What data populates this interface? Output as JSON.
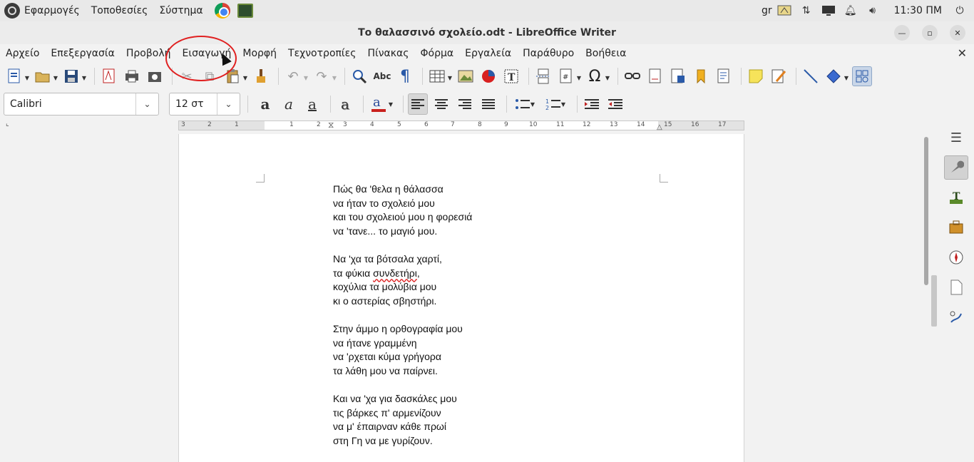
{
  "system_panel": {
    "menus": [
      "Εφαρμογές",
      "Τοποθεσίες",
      "Σύστημα"
    ],
    "keyboard_layout": "gr",
    "clock": "11:30 ΠΜ"
  },
  "window": {
    "title": "Το θαλασσινό σχολείο.odt - LibreOffice Writer"
  },
  "menubar": {
    "items": [
      "Αρχείο",
      "Επεξεργασία",
      "Προβολή",
      "Εισαγωγή",
      "Μορφή",
      "Τεχνοτροπίες",
      "Πίνακας",
      "Φόρμα",
      "Εργαλεία",
      "Παράθυρο",
      "Βοήθεια"
    ],
    "highlighted": "Εισαγωγή"
  },
  "formatting": {
    "font_name": "Calibri",
    "font_size": "12 στ",
    "font_color": "#c9211e"
  },
  "ruler": {
    "ticks": [
      "3",
      "2",
      "1",
      "1",
      "2",
      "3",
      "4",
      "5",
      "6",
      "7",
      "8",
      "9",
      "10",
      "11",
      "12",
      "13",
      "14",
      "15",
      "16",
      "17"
    ]
  },
  "document": {
    "stanzas": [
      [
        "Πώς θα 'θελα η θάλασσα",
        "να ήταν το σχολειό μου",
        "και του σχολειού μου η φορεσιά",
        "να 'τανε... το μαγιό μου."
      ],
      [
        "Να 'χα τα βότσαλα χαρτί,",
        "τα φύκια ",
        "κοχύλια τα μολύβια μου",
        "κι ο αστερίας σβηστήρι."
      ],
      [
        "Στην άμμο η ορθογραφία μου",
        "να ήτανε γραμμένη",
        "να 'ρχεται κύμα γρήγορα",
        "τα λάθη μου να παίρνει."
      ],
      [
        "Και να 'χα για δασκάλες μου",
        "τις βάρκες π' αρμενίζουν",
        "να μ' έπαιρναν κάθε πρωί",
        "στη Γη να με γυρίζουν."
      ]
    ],
    "misspelled_word": "συνδετήρι"
  },
  "colors": {
    "annotation": "#e02020",
    "accent_selected": "#c9d6e8"
  }
}
